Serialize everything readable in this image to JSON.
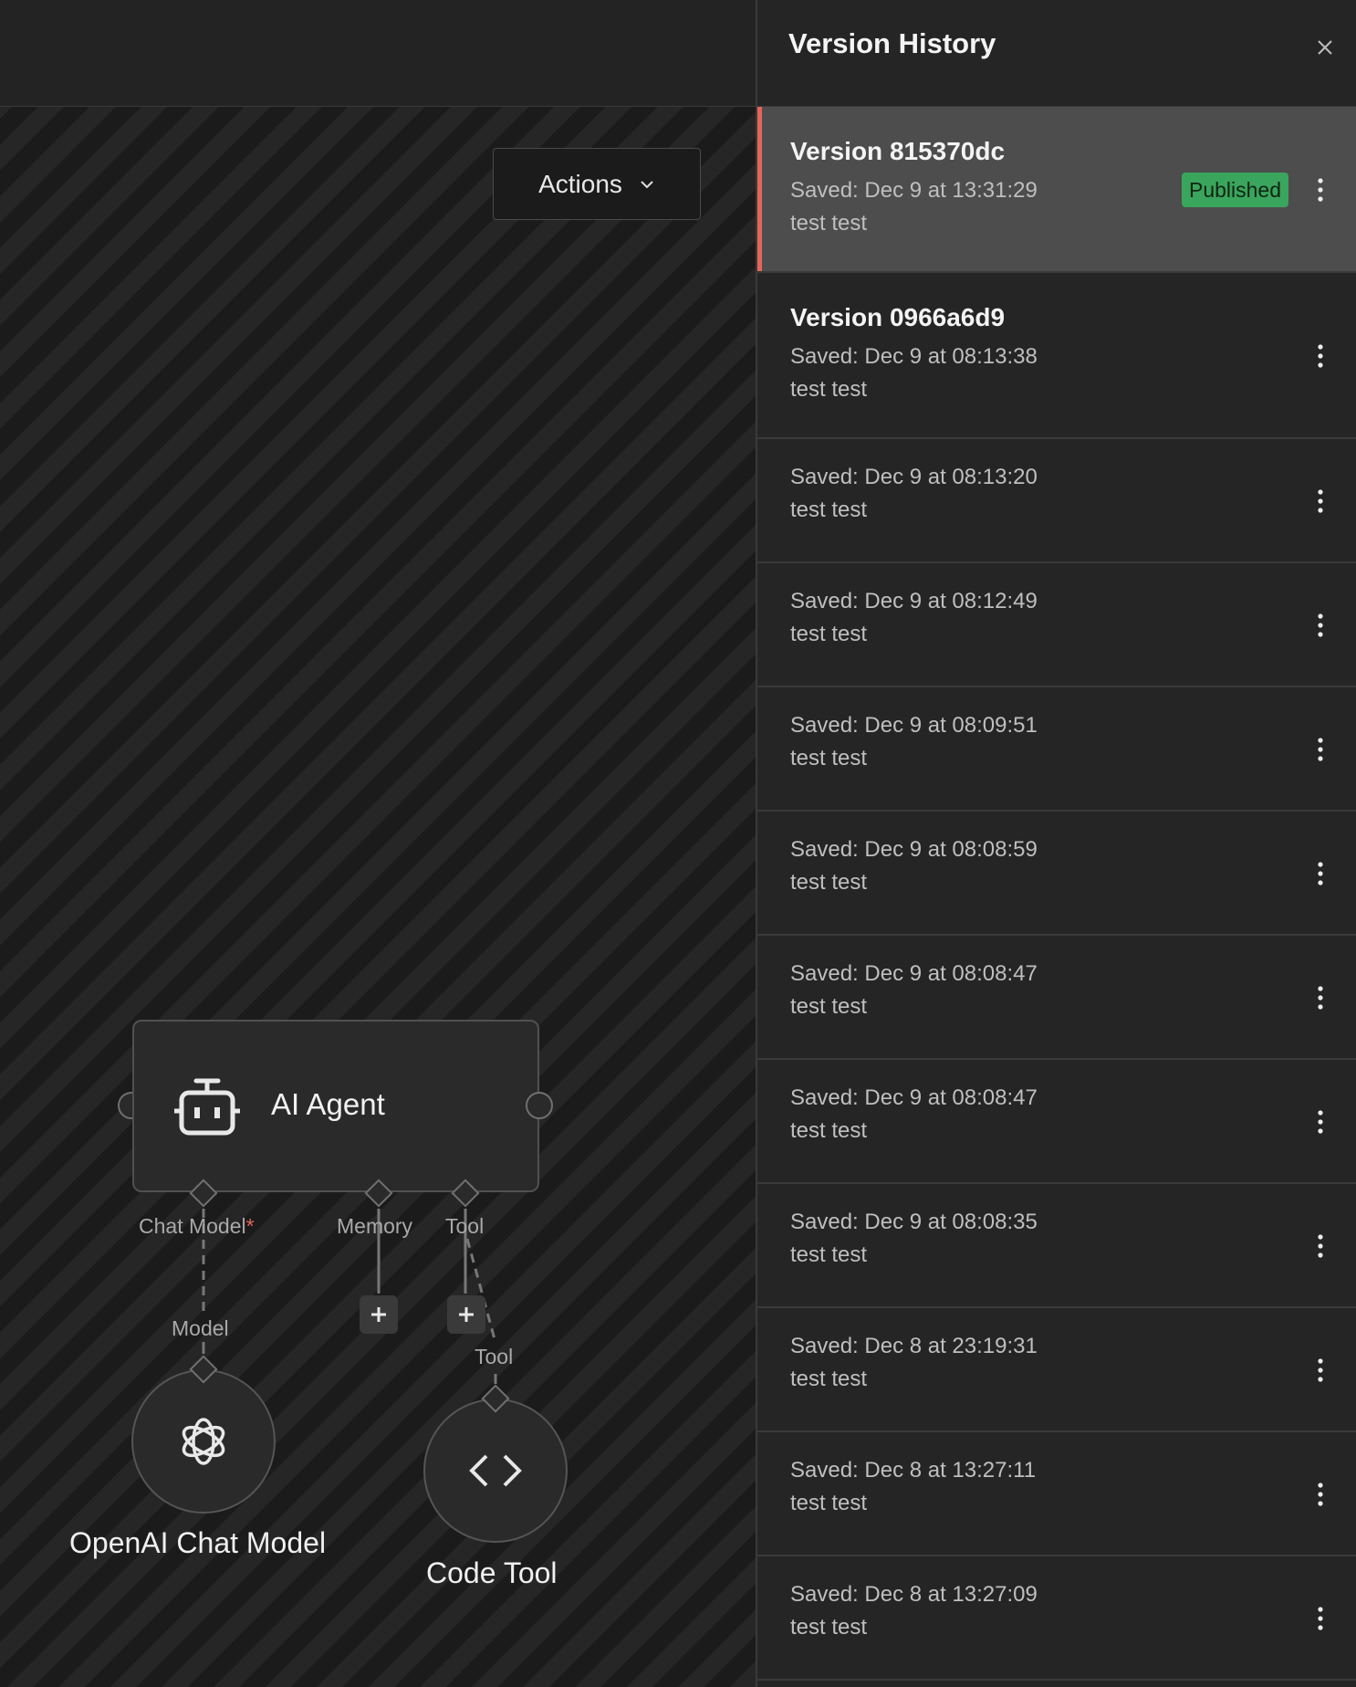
{
  "panel": {
    "title": "Version History",
    "versions": [
      {
        "name": "Version 815370dc",
        "saved": "Saved: Dec 9 at 13:31:29",
        "description": "test test",
        "badge": "Published",
        "active": true
      },
      {
        "name": "Version 0966a6d9",
        "saved": "Saved: Dec 9 at 08:13:38",
        "description": "test test"
      },
      {
        "saved": "Saved: Dec 9 at 08:13:20",
        "description": "test test"
      },
      {
        "saved": "Saved: Dec 9 at 08:12:49",
        "description": "test test"
      },
      {
        "saved": "Saved: Dec 9 at 08:09:51",
        "description": "test test"
      },
      {
        "saved": "Saved: Dec 9 at 08:08:59",
        "description": "test test"
      },
      {
        "saved": "Saved: Dec 9 at 08:08:47",
        "description": "test test"
      },
      {
        "saved": "Saved: Dec 9 at 08:08:47",
        "description": "test test"
      },
      {
        "saved": "Saved: Dec 9 at 08:08:35",
        "description": "test test"
      },
      {
        "saved": "Saved: Dec 8 at 23:19:31",
        "description": "test test"
      },
      {
        "saved": "Saved: Dec 8 at 13:27:11",
        "description": "test test"
      },
      {
        "saved": "Saved: Dec 8 at 13:27:09",
        "description": "test test"
      }
    ]
  },
  "canvas": {
    "actions_label": "Actions",
    "agent": {
      "title": "AI Agent",
      "ports": {
        "chat_model": "Chat Model",
        "required_mark": "*",
        "memory": "Memory",
        "tool": "Tool"
      }
    },
    "openai_node": {
      "port_label": "Model",
      "title": "OpenAI Chat Model"
    },
    "code_node": {
      "port_label": "Tool",
      "title": "Code Tool"
    }
  },
  "colors": {
    "accent": "#e5645c",
    "published_badge": "#3aa55c"
  },
  "icons": [
    "chevron-down-icon",
    "robot-icon",
    "openai-icon",
    "code-icon",
    "plus-icon",
    "close-icon",
    "kebab-menu-icon"
  ]
}
